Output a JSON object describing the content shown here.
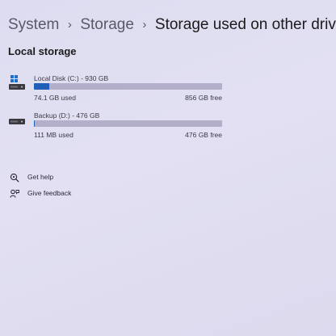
{
  "breadcrumb": {
    "items": [
      "System",
      "Storage",
      "Storage used on other drives"
    ]
  },
  "section_title": "Local storage",
  "drives": [
    {
      "name": "Local Disk (C:) - 930 GB",
      "used": "74.1 GB used",
      "free": "856 GB free",
      "used_fraction": 0.08,
      "icon": "windows-drive-icon"
    },
    {
      "name": "Backup (D:) - 476 GB",
      "used": "111 MB used",
      "free": "476 GB free",
      "used_fraction": 0.0002,
      "icon": "drive-icon"
    }
  ],
  "links": [
    {
      "label": "Get help",
      "icon": "help-icon"
    },
    {
      "label": "Give feedback",
      "icon": "feedback-icon"
    }
  ],
  "colors": {
    "accent": "#1f5fb8",
    "bar_track": "#b3afca",
    "background": "#dedcf0"
  }
}
